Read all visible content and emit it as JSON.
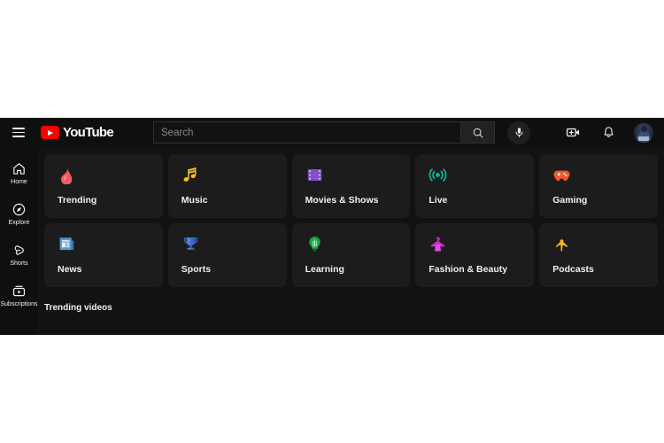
{
  "masthead": {
    "menu_icon": "hamburger-icon",
    "brand": "YouTube",
    "logo_icon": "youtube-play-icon",
    "search": {
      "value": "",
      "placeholder": "Search",
      "search_icon": "search-icon",
      "voice_icon": "microphone-icon"
    },
    "create_icon": "video-camera-plus-icon",
    "notifications_icon": "bell-icon",
    "avatar_icon": "user-avatar"
  },
  "sidebar": {
    "items": [
      {
        "label": "Home",
        "icon": "home-icon"
      },
      {
        "label": "Explore",
        "icon": "compass-icon"
      },
      {
        "label": "Shorts",
        "icon": "shorts-icon"
      },
      {
        "label": "Subscriptions",
        "icon": "subscriptions-icon"
      }
    ]
  },
  "main": {
    "categories": [
      {
        "label": "Trending",
        "icon": "flame-emoji",
        "color": "#f15b62"
      },
      {
        "label": "Music",
        "icon": "music-note-emoji",
        "color": "#f5bd1f"
      },
      {
        "label": "Movies & Shows",
        "icon": "film-strip-emoji",
        "color": "#8250c8"
      },
      {
        "label": "Live",
        "icon": "broadcast-emoji",
        "color": "#00c194"
      },
      {
        "label": "Gaming",
        "icon": "gamepad-emoji",
        "color": "#f0592b"
      },
      {
        "label": "News",
        "icon": "newspaper-emoji",
        "color": "#4a90e2"
      },
      {
        "label": "Sports",
        "icon": "trophy-emoji",
        "color": "#3c63c8"
      },
      {
        "label": "Learning",
        "icon": "lightbulb-emoji",
        "color": "#17a84a"
      },
      {
        "label": "Fashion & Beauty",
        "icon": "hanger-emoji",
        "color": "#d22bd2"
      },
      {
        "label": "Podcasts",
        "icon": "podcast-emoji",
        "color": "#f5b91f"
      }
    ],
    "trending_section_title": "Trending videos"
  },
  "theme": {
    "page_bg": "#121212",
    "bar_bg": "#0f0f0f",
    "card_bg": "#1c1c1c",
    "text": "#f1f1f1",
    "brand_red": "#ff0000",
    "placeholder": "#888888"
  }
}
